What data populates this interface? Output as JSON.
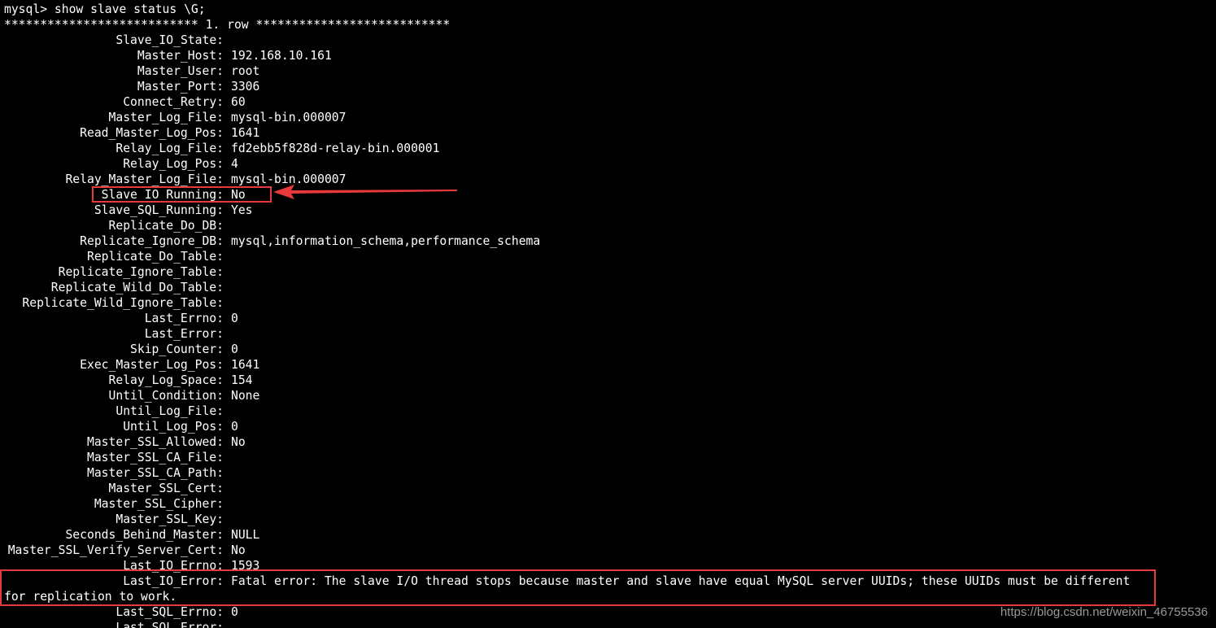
{
  "terminal": {
    "prompt_line": "mysql> show slave status \\G;",
    "row_header": "*************************** 1. row ***************************",
    "fields": [
      {
        "label": "Slave_IO_State:",
        "value": ""
      },
      {
        "label": "Master_Host:",
        "value": "192.168.10.161"
      },
      {
        "label": "Master_User:",
        "value": "root"
      },
      {
        "label": "Master_Port:",
        "value": "3306"
      },
      {
        "label": "Connect_Retry:",
        "value": "60"
      },
      {
        "label": "Master_Log_File:",
        "value": "mysql-bin.000007"
      },
      {
        "label": "Read_Master_Log_Pos:",
        "value": "1641"
      },
      {
        "label": "Relay_Log_File:",
        "value": "fd2ebb5f828d-relay-bin.000001"
      },
      {
        "label": "Relay_Log_Pos:",
        "value": "4"
      },
      {
        "label": "Relay_Master_Log_File:",
        "value": "mysql-bin.000007"
      },
      {
        "label": "Slave_IO_Running:",
        "value": "No"
      },
      {
        "label": "Slave_SQL_Running:",
        "value": "Yes"
      },
      {
        "label": "Replicate_Do_DB:",
        "value": ""
      },
      {
        "label": "Replicate_Ignore_DB:",
        "value": "mysql,information_schema,performance_schema"
      },
      {
        "label": "Replicate_Do_Table:",
        "value": ""
      },
      {
        "label": "Replicate_Ignore_Table:",
        "value": ""
      },
      {
        "label": "Replicate_Wild_Do_Table:",
        "value": ""
      },
      {
        "label": "Replicate_Wild_Ignore_Table:",
        "value": ""
      },
      {
        "label": "Last_Errno:",
        "value": "0"
      },
      {
        "label": "Last_Error:",
        "value": ""
      },
      {
        "label": "Skip_Counter:",
        "value": "0"
      },
      {
        "label": "Exec_Master_Log_Pos:",
        "value": "1641"
      },
      {
        "label": "Relay_Log_Space:",
        "value": "154"
      },
      {
        "label": "Until_Condition:",
        "value": "None"
      },
      {
        "label": "Until_Log_File:",
        "value": ""
      },
      {
        "label": "Until_Log_Pos:",
        "value": "0"
      },
      {
        "label": "Master_SSL_Allowed:",
        "value": "No"
      },
      {
        "label": "Master_SSL_CA_File:",
        "value": ""
      },
      {
        "label": "Master_SSL_CA_Path:",
        "value": ""
      },
      {
        "label": "Master_SSL_Cert:",
        "value": ""
      },
      {
        "label": "Master_SSL_Cipher:",
        "value": ""
      },
      {
        "label": "Master_SSL_Key:",
        "value": ""
      },
      {
        "label": "Seconds_Behind_Master:",
        "value": "NULL"
      },
      {
        "label": "Master_SSL_Verify_Server_Cert:",
        "value": "No"
      },
      {
        "label": "Last_IO_Errno:",
        "value": "1593"
      },
      {
        "label": "Last_IO_Error:",
        "value": "Fatal error: The slave I/O thread stops because master and slave have equal MySQL server UUIDs; these UUIDs must be different"
      },
      {
        "label": "Last_SQL_Errno:",
        "value": "0"
      },
      {
        "label": "Last_SQL_Error:",
        "value": ""
      }
    ],
    "io_error_continuation": "for replication to work."
  },
  "annotations": {
    "highlight_color": "#e83a3a"
  },
  "watermark": "https://blog.csdn.net/weixin_46755536"
}
